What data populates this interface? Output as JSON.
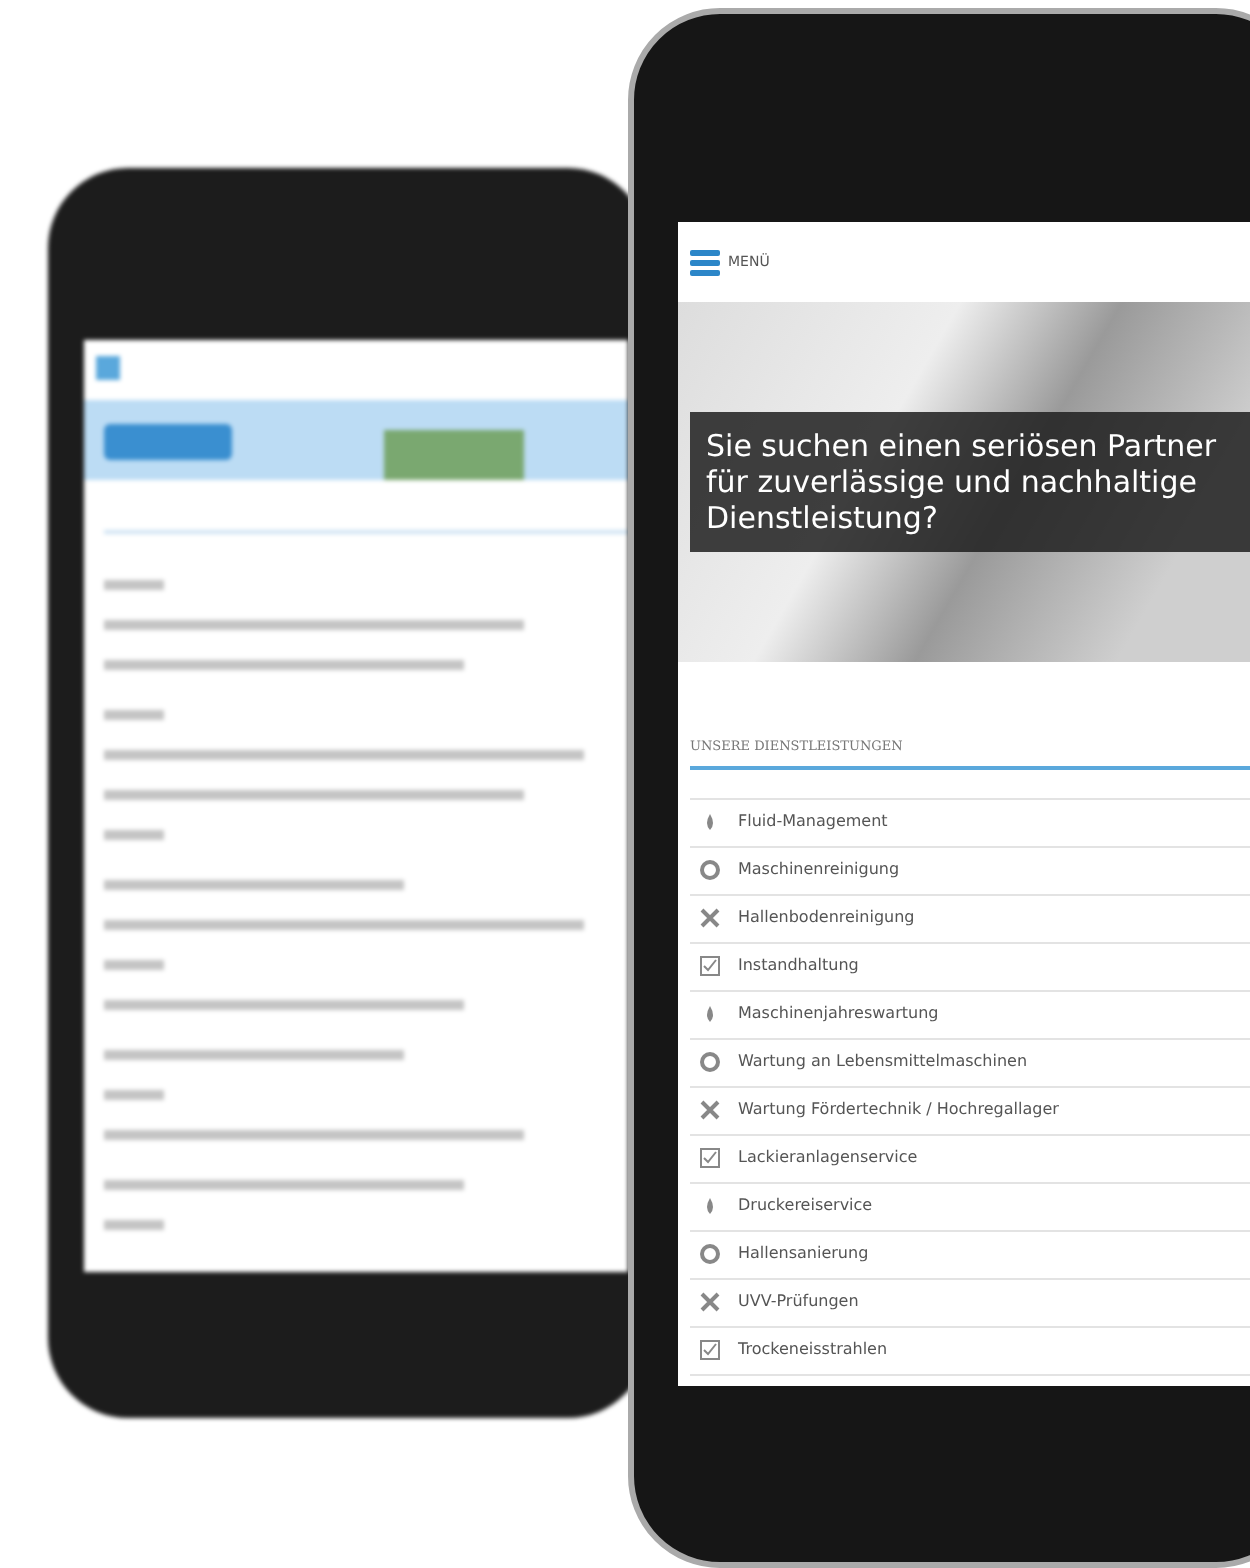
{
  "front_phone": {
    "header": {
      "menu_label": "MENÜ"
    },
    "hero": {
      "caption": "Sie suchen einen seriösen Partner für zuverlässige und nachhaltige Dienstleistung?"
    },
    "services": {
      "heading": "UNSERE DIENSTLEISTUNGEN",
      "items": [
        "Fluid-Management",
        "Maschinenreinigung",
        "Hallenbodenreinigung",
        "Instandhaltung",
        "Maschinenjahreswartung",
        "Wartung an Lebensmittelmaschinen",
        "Wartung Fördertechnik / Hochregallager",
        "Lackieranlagenservice",
        "Druckereiservice",
        "Hallensanierung",
        "UVV-Prüfungen",
        "Trockeneisstrahlen"
      ]
    }
  }
}
